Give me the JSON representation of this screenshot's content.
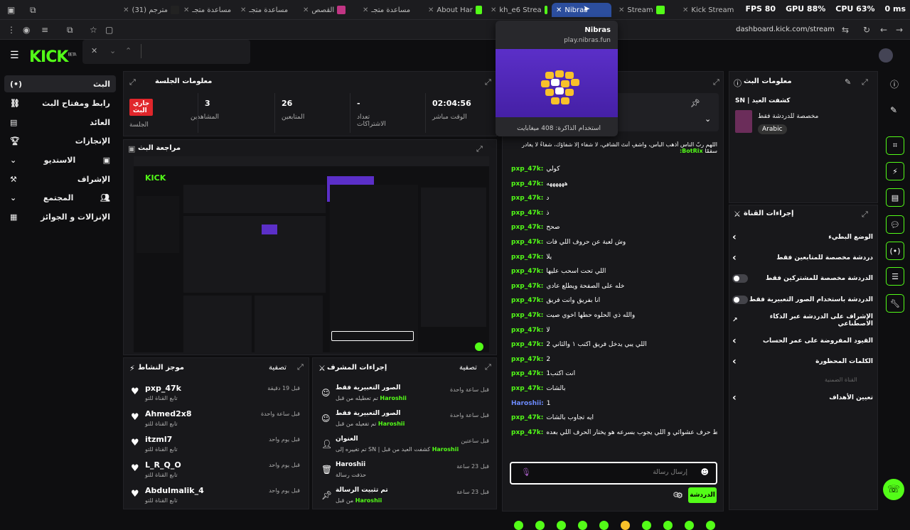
{
  "browser": {
    "tabs": [
      {
        "label": "(31) مترجم",
        "icon": "tiktok-icon"
      },
      {
        "label": "مساعدة متجـ"
      },
      {
        "label": "مساعدة متجـ"
      },
      {
        "label": "القصص"
      },
      {
        "label": "مساعدة متجـ"
      },
      {
        "label": "About Har"
      },
      {
        "label": "kh_e6 Strea"
      },
      {
        "label": "Nibras"
      },
      {
        "label": "Stream"
      },
      {
        "label": "Kick Stream"
      }
    ],
    "perf": {
      "fps": "FPS 80",
      "gpu": "GPU 88%",
      "cpu": "CPU 63%",
      "ping": "0 ms"
    },
    "url": "dashboard.kick.com/stream"
  },
  "popup": {
    "title": "Nibras",
    "url": "play.nibras.fun",
    "memory": "استخدام الذاكرة: 408 ميغابايت"
  },
  "kick": {
    "logo": "KICK",
    "beta": "BETA"
  },
  "sidebar": {
    "items": [
      {
        "label": "البث",
        "icon": "live-icon"
      },
      {
        "label": "رابط ومفتاح البث",
        "icon": "link-icon"
      },
      {
        "label": "العائد",
        "icon": "chart-icon"
      },
      {
        "label": "الإنجازات",
        "icon": "trophy-icon"
      },
      {
        "label": "الاستديو",
        "icon": "studio-icon"
      },
      {
        "label": "الإشراف",
        "icon": "hammer-icon"
      },
      {
        "label": "المجتمع",
        "icon": "community-icon"
      },
      {
        "label": "الإنزالات و الجوائز",
        "icon": "gift-icon"
      }
    ]
  },
  "session": {
    "title": "معلومات الجلسة",
    "live": "جاري البث",
    "session_label": "الجلسة",
    "viewers": "3",
    "viewers_label": "المشاهدين",
    "followers": "26",
    "followers_label": "المتابعين",
    "subs": "-",
    "subs_label": "تعداد الاشتراكات",
    "uptime": "02:04:56",
    "uptime_label": "الوقت مباشر"
  },
  "review": {
    "title": "مراجعة البث"
  },
  "activity": {
    "title": "موجز النشاط",
    "filter": "تصفية",
    "rows": [
      {
        "name": "pxp_47k",
        "sub": "تابع القناة للتو",
        "time": "قبل 19 دقيقة"
      },
      {
        "name": "Ahmed2x8",
        "sub": "تابع القناة للتو",
        "time": "قبل ساعة واحدة"
      },
      {
        "name": "itzml7",
        "sub": "تابع القناة للتو",
        "time": "قبل يوم واحد"
      },
      {
        "name": "L_R_Q_O",
        "sub": "تابع القناة للتو",
        "time": "قبل يوم واحد"
      },
      {
        "name": "Abdulmalik_4",
        "sub": "تابع القناة للتو",
        "time": "قبل يوم واحد"
      }
    ]
  },
  "modactions": {
    "title": "إجراءات المشرف",
    "filter": "تصفية",
    "rows": [
      {
        "action": "الصور التعبيرية فقط",
        "user": "Haroshii",
        "detail": "تم تعطيله من قبل",
        "time": "قبل ساعة واحدة"
      },
      {
        "action": "الصور التعبيرية فقط",
        "user": "Haroshii",
        "detail": "تم تفعيله من قبل",
        "time": "قبل ساعة واحدة"
      },
      {
        "action": "العنوان",
        "user": "Haroshii",
        "detail": "تم تغييره إلى SN | كشفت العيد من قبل",
        "time": "قبل ساعتين"
      },
      {
        "action": "Haroshii",
        "user": "",
        "detail": "حذفت رسالة",
        "time": "قبل 23 ساعة"
      },
      {
        "action": "تم تثبيت الرسالة",
        "user": "Haroshii",
        "detail": "من قبل",
        "time": "قبل 23 ساعة"
      }
    ]
  },
  "chat": {
    "pinned": "اللهم ربّ الناس أذهب البأس، واشفِ أنتَ الشافي، لا شفاء إلا شفاؤك، شفاءً لا يغادر سقمًا",
    "pinned_user": "BotRix:",
    "messages": [
      {
        "user": "pxp_47k:",
        "text": "كولي"
      },
      {
        "user": "pxp_47k:",
        "text": "ههههههه"
      },
      {
        "user": "pxp_47k:",
        "text": "د"
      },
      {
        "user": "pxp_47k:",
        "text": "ذ"
      },
      {
        "user": "pxp_47k:",
        "text": "صحح"
      },
      {
        "user": "pxp_47k:",
        "text": "وش لعبة عن حروف اللي فات"
      },
      {
        "user": "pxp_47k:",
        "text": "يلا"
      },
      {
        "user": "pxp_47k:",
        "text": "اللي تحت اسحب عليها"
      },
      {
        "user": "pxp_47k:",
        "text": "خله على الصفحة ويطلع عادي"
      },
      {
        "user": "pxp_47k:",
        "text": "أنا بفريق وأنت فريق"
      },
      {
        "user": "pxp_47k:",
        "text": "والله ذي الحلوه حطها اخوي صيت"
      },
      {
        "user": "pxp_47k:",
        "text": "لا"
      },
      {
        "user": "pxp_47k:",
        "text": "اللي يبي يدخل فريق اكتب ١ والثاني 2"
      },
      {
        "user": "pxp_47k:",
        "text": "2"
      },
      {
        "user": "pxp_47k:",
        "text": "انت اكتب1"
      },
      {
        "user": "pxp_47k:",
        "text": "بالشات"
      },
      {
        "user": "Haroshii:",
        "text": "1"
      },
      {
        "user": "pxp_47k:",
        "text": "ايه تجاوب بالشات"
      },
      {
        "user": "pxp_47k:",
        "text": "حط حرف عشوائي و اللي يجوب بسرعه هو يختار الحرف اللي بعده"
      }
    ],
    "input_placeholder": "إرسال رسالة",
    "send": "الدردشة"
  },
  "streaminfo": {
    "title": "معلومات البث",
    "stream_title": "SN | كشفت العيد",
    "category": "مخصصة للدردشة فقط",
    "language": "Arabic"
  },
  "channelactions": {
    "title": "إجراءات القناة",
    "rows": [
      {
        "label": "الوضع البطيء",
        "control": "chevron"
      },
      {
        "label": "دردشة مخصصة للمتابعين فقط",
        "control": "chevron"
      },
      {
        "label": "الدردشة مخصصة للمشتركين فقط",
        "control": "toggle"
      },
      {
        "label": "الدردشة باستخدام الصور التعبيرية فقط",
        "control": "toggle"
      },
      {
        "label": "الإشراف على الدردشة عبر الذكاء الاصطناعي",
        "control": "external"
      },
      {
        "label": "القيود المفروضة على عمر الحساب",
        "control": "chevron"
      },
      {
        "label": "الكلمات المحظورة",
        "control": "chevron"
      }
    ],
    "section": "القناة الضمنية",
    "targets": "تعيين الأهداف"
  }
}
